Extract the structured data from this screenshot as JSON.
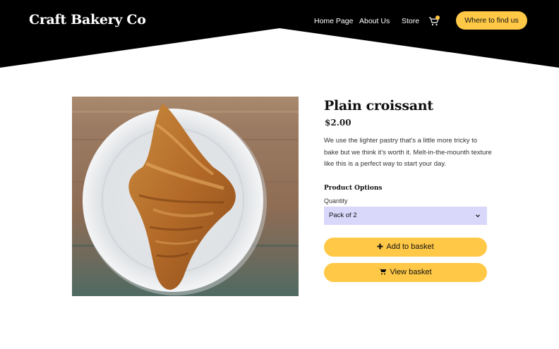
{
  "header": {
    "brand": "Craft Bakery Co",
    "nav": {
      "home": "Home Page",
      "about": "About Us",
      "store": "Store"
    },
    "cart_icon": "shopping-cart-icon",
    "cta_label": "Where to find us"
  },
  "product": {
    "title": "Plain croissant",
    "price": "$2.00",
    "description": "We use the lighter pastry that's a little more tricky to bake but we think it's worth it. Melt-in-the-mounth texture like this is a perfect way to start your day.",
    "options_title": "Product Options",
    "quantity_label": "Quantity",
    "quantity_selected": "Pack of 2",
    "add_label": "Add to basket",
    "view_label": "View basket",
    "add_icon": "plus-icon",
    "view_icon": "shopping-cart-icon"
  },
  "colors": {
    "header_bg": "#000000",
    "accent": "#ffc846",
    "select_bg": "#d9d8fb"
  }
}
